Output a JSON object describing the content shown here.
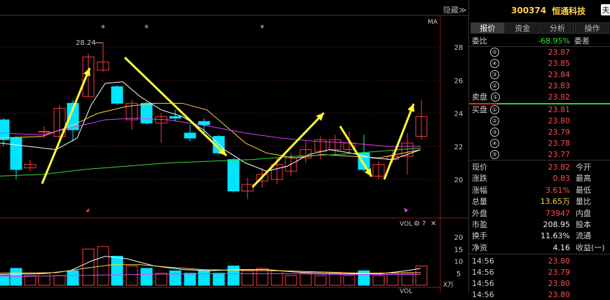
{
  "chart": {
    "hide_label": "隐藏≫",
    "ma_label": "MA",
    "high_mark": "28.24",
    "star": "*",
    "price_ticks": [
      "28",
      "26",
      "24",
      "22",
      "20"
    ],
    "vol_label": "VOL",
    "vol_ticks": [
      "20",
      "15",
      "10",
      "5"
    ],
    "vol_unit": "X万",
    "vol_bottom_label": "VOL",
    "colors": {
      "up": "#ff3b3b",
      "down": "#00e5ff",
      "ma5": "#ffffff",
      "ma10": "#ffd24a",
      "ma20": "#e040fb",
      "ma60": "#33dd33",
      "arrow": "#ffff33"
    }
  },
  "quote": {
    "code": "300374",
    "name": "恒通科技",
    "corner_button": "夫",
    "tabs": [
      "报价",
      "资金",
      "分析",
      "操作"
    ],
    "weibi_label": "委比",
    "weibi_value": "-68.95%",
    "weicha_label": "委差",
    "sell_label": "卖盘",
    "buy_label": "买盘",
    "sell": [
      {
        "n": "⑤",
        "price": "23.87"
      },
      {
        "n": "④",
        "price": "23.85"
      },
      {
        "n": "③",
        "price": "23.84"
      },
      {
        "n": "②",
        "price": "23.83"
      },
      {
        "n": "①",
        "price": "23.82"
      }
    ],
    "buy": [
      {
        "n": "①",
        "price": "23.81"
      },
      {
        "n": "②",
        "price": "23.80"
      },
      {
        "n": "③",
        "price": "23.79"
      },
      {
        "n": "④",
        "price": "23.78"
      },
      {
        "n": "⑤",
        "price": "23.77"
      }
    ],
    "stats": [
      {
        "label": "现价",
        "value": "23.82",
        "color": "red",
        "ext": "今开"
      },
      {
        "label": "涨跌",
        "value": "0.83",
        "color": "red",
        "ext": "最高"
      },
      {
        "label": "涨幅",
        "value": "3.61%",
        "color": "red",
        "ext": "最低"
      },
      {
        "label": "总量",
        "value": "13.65万",
        "color": "yellow",
        "ext": "量比"
      },
      {
        "label": "外盘",
        "value": "73947",
        "color": "red",
        "ext": "内盘"
      },
      {
        "label": "市盈",
        "value": "208.95",
        "color": "white",
        "ext": "股本"
      },
      {
        "label": "换手",
        "value": "11.63%",
        "color": "white",
        "ext": "流通"
      },
      {
        "label": "净资",
        "value": "4.16",
        "color": "white",
        "ext": "收益(一)"
      }
    ],
    "ticks": [
      {
        "time": "14:56",
        "price": "23.80"
      },
      {
        "time": "14:56",
        "price": "23.79"
      },
      {
        "time": "14:56",
        "price": "23.80"
      },
      {
        "time": "14:56",
        "price": "23.80"
      }
    ]
  }
}
